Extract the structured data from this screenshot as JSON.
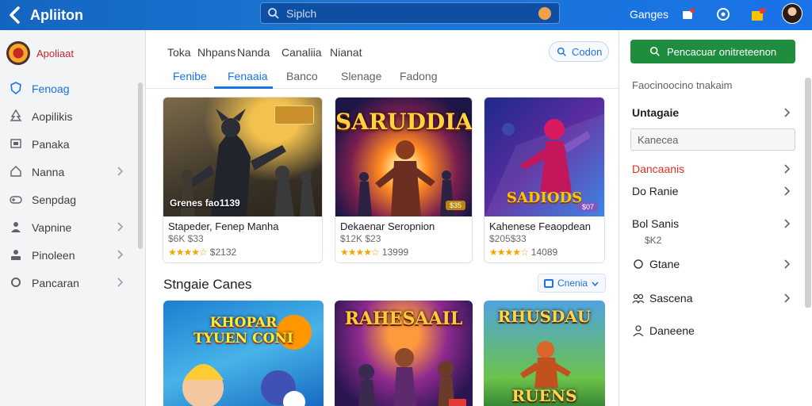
{
  "topbar": {
    "title": "Apliiton",
    "search_placeholder": "Siplch",
    "link": "Ganges"
  },
  "sidebar": {
    "brand": "Apoliaat",
    "items": [
      {
        "label": "Fenoag",
        "icon": "shield-icon",
        "active": true
      },
      {
        "label": "Aopilikis",
        "icon": "tree-icon"
      },
      {
        "label": "Panaka",
        "icon": "image-icon"
      },
      {
        "label": "Nanna",
        "icon": "home-icon",
        "chevron": true
      },
      {
        "label": "Senpdag",
        "icon": "gamepad-icon"
      },
      {
        "label": "Vapnine",
        "icon": "person-icon",
        "chevron": true
      },
      {
        "label": "Pinoleen",
        "icon": "user-card-icon",
        "chevron": true
      },
      {
        "label": "Pancaran",
        "icon": "circle-icon",
        "chevron": true
      }
    ]
  },
  "main": {
    "top_links": [
      "Toka",
      "Nhpans",
      "Nanda",
      "Canaliia",
      "Nianat"
    ],
    "code_button": "Codon",
    "tabs": [
      "Fenibe",
      "Fenaaia",
      "Banco",
      "Slenage",
      "Fadong"
    ],
    "active_tab": 1,
    "cards": [
      {
        "art_label": "Grenes fao1139",
        "title": "Stapeder, Fenep Manha",
        "price": "$6K $33",
        "rating": "$2132"
      },
      {
        "art_headline": "SARUDDIAN",
        "badge": "$35",
        "title": "Dekaenar Seropnion",
        "price": "$12K $23",
        "rating": "13999"
      },
      {
        "art_headline": "SADIODS",
        "badge": "$07",
        "title": "Kahenese Feaopdean",
        "price": "$205$33",
        "rating": "14089"
      }
    ],
    "section_title": "Stngaie Canes",
    "filter_label": "Cnenia",
    "cards2": [
      {
        "art_headline": "KHOPAR TYUEN CONI"
      },
      {
        "art_headline": "RAHESAAIL"
      },
      {
        "art_headline": "RHUSDAU",
        "art_sub": "RUENS"
      }
    ]
  },
  "rpanel": {
    "button": "Pencacuar onitreteenon",
    "subtitle": "Faocinoocino tnakaim",
    "row1": "Untagaie",
    "input": "Kanecea",
    "row2": "Dancaanis",
    "row3": "Do Ranie",
    "row4": "Bol Sanis",
    "note": "$K2",
    "row5": "Gtane",
    "row6": "Sascena",
    "row7": "Daneene"
  }
}
